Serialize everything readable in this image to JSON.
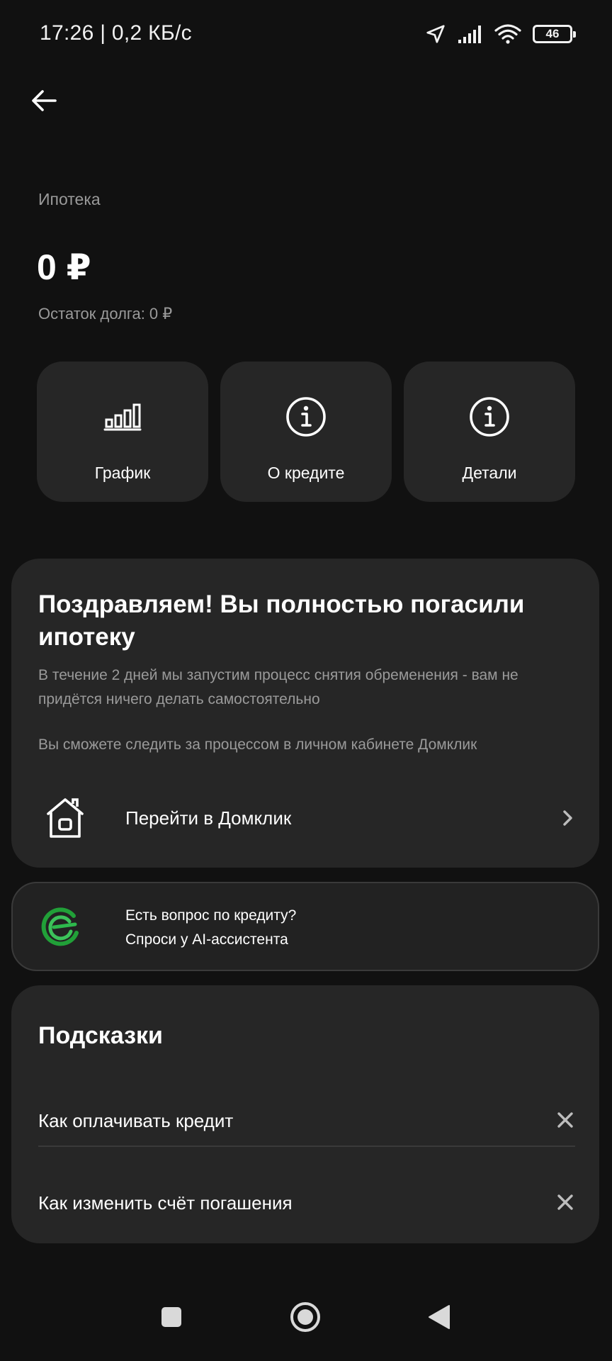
{
  "status_bar": {
    "time": "17:26 | 0,2 КБ/с",
    "battery": "46",
    "icons": [
      "location-arrow-icon",
      "signal-icon",
      "wifi-icon",
      "battery-icon"
    ]
  },
  "header": {
    "back_icon": "arrow-left-icon"
  },
  "product": {
    "label": "Ипотека",
    "balance": "0 ₽",
    "debt_rest": "Остаток долга: 0 ₽"
  },
  "actions": [
    {
      "label": "График",
      "icon": "bar-chart-icon"
    },
    {
      "label": "О кредите",
      "icon": "info-icon"
    },
    {
      "label": "Детали",
      "icon": "info-icon"
    }
  ],
  "congrats": {
    "title": "Поздравляем! Вы полностью погасили ипотеку",
    "text1": "В течение 2 дней мы запустим процесс снятия обременения - вам не придётся ничего делать самостоятельно",
    "text2": "Вы сможете следить за процессом в личном кабинете Домклик",
    "link_label": "Перейти в Домклик",
    "link_icon": "house-icon"
  },
  "assistant": {
    "line1": "Есть вопрос по кредиту?",
    "line2": "Спроси у AI-ассистента",
    "logo": "sber-logo-icon"
  },
  "tips": {
    "title": "Подсказки",
    "items": [
      {
        "label": "Как оплачивать кредит"
      },
      {
        "label": "Как изменить счёт погашения"
      }
    ]
  },
  "nav": [
    "recents-icon",
    "home-icon",
    "back-icon"
  ],
  "colors": {
    "background": "#111111",
    "card": "#262626",
    "text_secondary": "#9a9a9a",
    "accent_green": "#21a038"
  }
}
